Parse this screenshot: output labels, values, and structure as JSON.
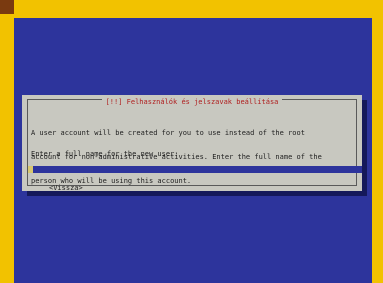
{
  "dialog": {
    "title": "[!!] Felhasználók és jelszavak beállítása",
    "description_lines": [
      "A user account will be created for you to use instead of the root",
      "account for non-administrative activities. Enter the full name of the",
      "person who will be using this account."
    ],
    "prompt": "Enter a full name for the new user:",
    "input_value": "",
    "back_label": "<Vissza>"
  },
  "colors": {
    "outer_frame": "#F2C200",
    "screen_background": "#2D349C",
    "dialog_background": "#C8C8C0",
    "title_text": "#B02020"
  }
}
